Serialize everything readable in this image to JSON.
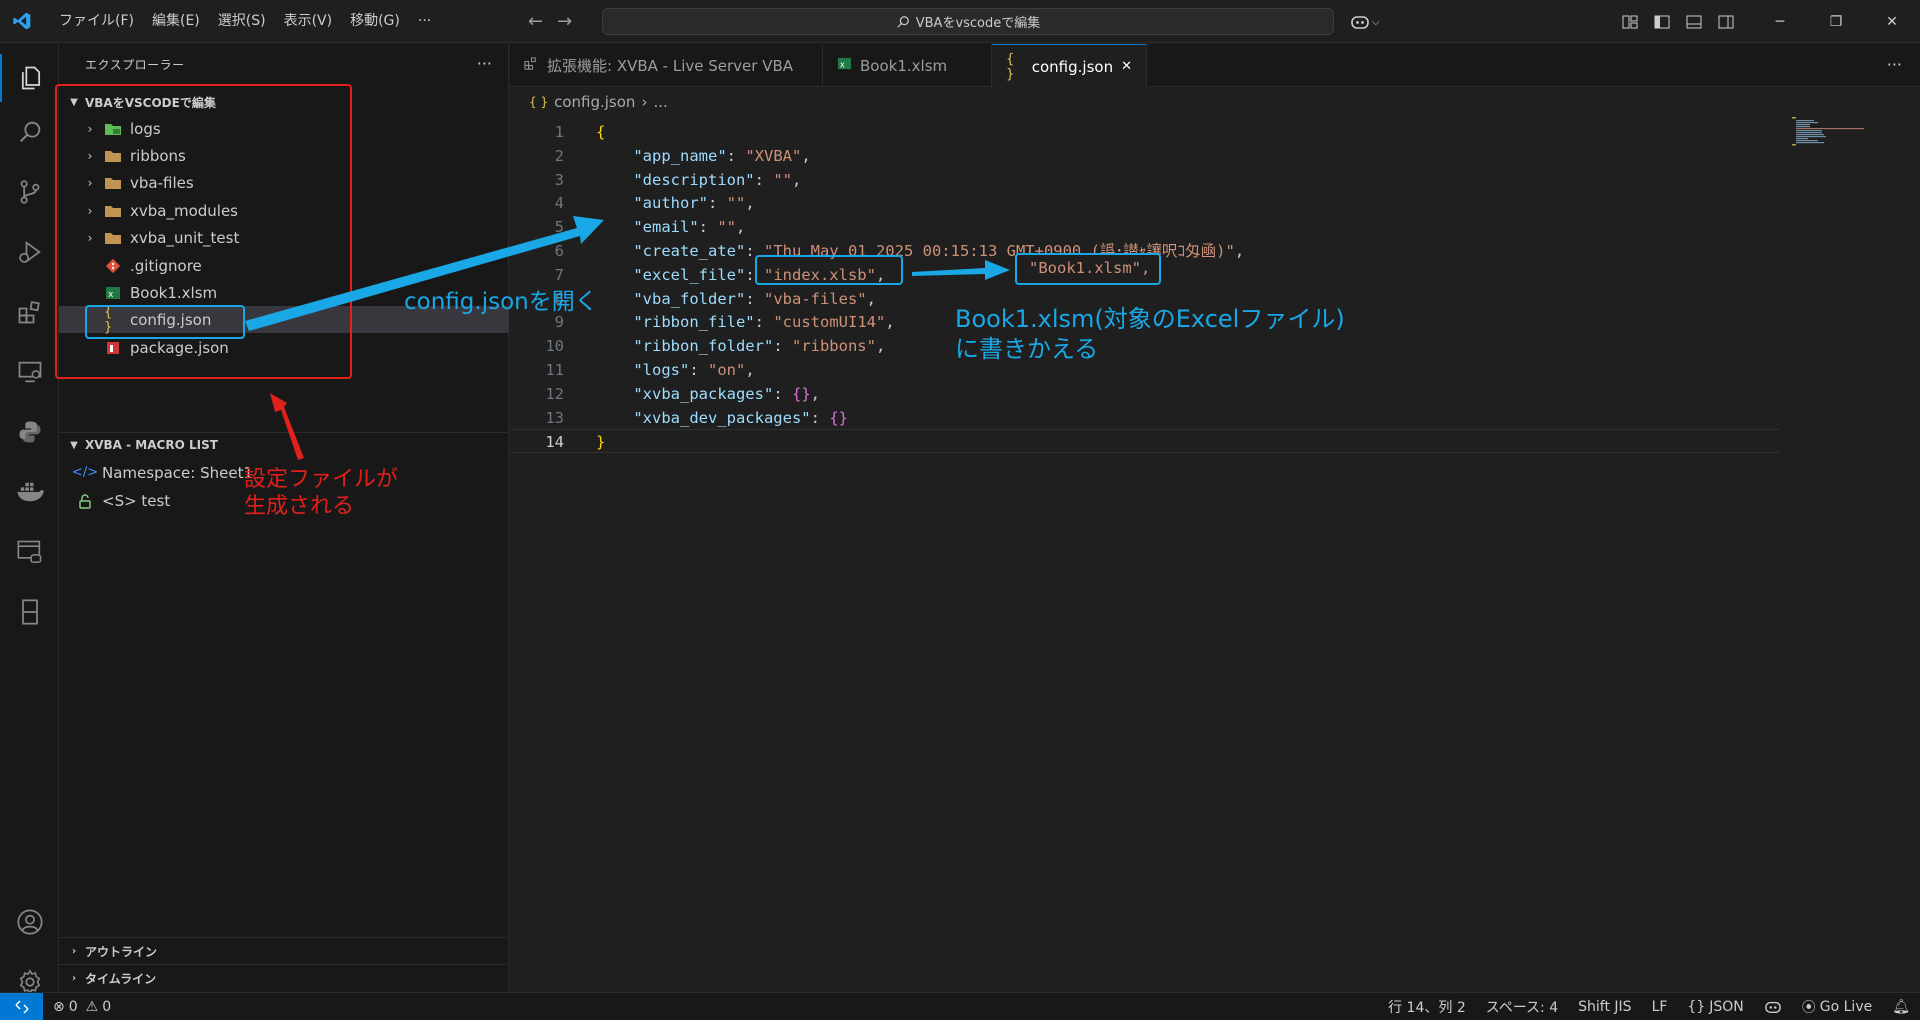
{
  "titlebar": {
    "menu": [
      "ファイル(F)",
      "編集(E)",
      "選択(S)",
      "表示(V)",
      "移動(G)",
      "···"
    ],
    "search_text": "VBAをvscodeで編集"
  },
  "sidebar": {
    "title": "エクスプローラー",
    "more": "···",
    "workspace_title": "VBAをVSCODEで編集",
    "tree": [
      {
        "label": "logs",
        "kind": "folder"
      },
      {
        "label": "ribbons",
        "kind": "folder"
      },
      {
        "label": "vba-files",
        "kind": "folder"
      },
      {
        "label": "xvba_modules",
        "kind": "folder"
      },
      {
        "label": "xvba_unit_test",
        "kind": "folder"
      },
      {
        "label": ".gitignore",
        "kind": "git"
      },
      {
        "label": "Book1.xlsm",
        "kind": "excel"
      },
      {
        "label": "config.json",
        "kind": "json"
      },
      {
        "label": "package.json",
        "kind": "npm"
      }
    ],
    "macro_title": "XVBA - MACRO LIST",
    "macro_items": [
      {
        "label": "Namespace: Sheet1",
        "icon": "code-icon"
      },
      {
        "label": "<S> test",
        "icon": "unlock-icon"
      }
    ],
    "outline_title": "アウトライン",
    "timeline_title": "タイムライン"
  },
  "tabs": [
    {
      "label": "拡張機能: XVBA - Live Server VBA",
      "icon": "extensions-icon"
    },
    {
      "label": "Book1.xlsm",
      "icon": "excel-icon"
    },
    {
      "label": "config.json",
      "icon": "json-icon",
      "close": "✕"
    }
  ],
  "breadcrumb": {
    "file": "config.json",
    "rest": "..."
  },
  "code": [
    {
      "n": "1",
      "parts": [
        [
          "b1",
          "{"
        ]
      ]
    },
    {
      "n": "2",
      "parts": [
        [
          "p",
          "    "
        ],
        [
          "k",
          "\"app_name\""
        ],
        [
          "p",
          ": "
        ],
        [
          "s",
          "\"XVBA\""
        ],
        [
          "p",
          ","
        ]
      ]
    },
    {
      "n": "3",
      "parts": [
        [
          "p",
          "    "
        ],
        [
          "k",
          "\"description\""
        ],
        [
          "p",
          ": "
        ],
        [
          "s",
          "\"\""
        ],
        [
          "p",
          ","
        ]
      ]
    },
    {
      "n": "4",
      "parts": [
        [
          "p",
          "    "
        ],
        [
          "k",
          "\"author\""
        ],
        [
          "p",
          ": "
        ],
        [
          "s",
          "\"\""
        ],
        [
          "p",
          ","
        ]
      ]
    },
    {
      "n": "5",
      "parts": [
        [
          "p",
          "    "
        ],
        [
          "k",
          "\"email\""
        ],
        [
          "p",
          ": "
        ],
        [
          "s",
          "\"\""
        ],
        [
          "p",
          ","
        ]
      ]
    },
    {
      "n": "6",
      "parts": [
        [
          "p",
          "    "
        ],
        [
          "k",
          "\"create_ate\""
        ],
        [
          "p",
          ": "
        ],
        [
          "s",
          "\"Thu May 01 2025 00:15:13 GMT+0900 (譌･譛ｬ讓呎ｺ匁凾)\""
        ],
        [
          "p",
          ","
        ]
      ]
    },
    {
      "n": "7",
      "parts": [
        [
          "p",
          "    "
        ],
        [
          "k",
          "\"excel_file\""
        ],
        [
          "p",
          ": "
        ],
        [
          "s",
          "\"index.xlsb\""
        ],
        [
          "p",
          ","
        ]
      ]
    },
    {
      "n": "8",
      "parts": [
        [
          "p",
          "    "
        ],
        [
          "k",
          "\"vba_folder\""
        ],
        [
          "p",
          ": "
        ],
        [
          "s",
          "\"vba-files\""
        ],
        [
          "p",
          ","
        ]
      ]
    },
    {
      "n": "9",
      "parts": [
        [
          "p",
          "    "
        ],
        [
          "k",
          "\"ribbon_file\""
        ],
        [
          "p",
          ": "
        ],
        [
          "s",
          "\"customUI14\""
        ],
        [
          "p",
          ","
        ]
      ]
    },
    {
      "n": "10",
      "parts": [
        [
          "p",
          "    "
        ],
        [
          "k",
          "\"ribbon_folder\""
        ],
        [
          "p",
          ": "
        ],
        [
          "s",
          "\"ribbons\""
        ],
        [
          "p",
          ","
        ]
      ]
    },
    {
      "n": "11",
      "parts": [
        [
          "p",
          "    "
        ],
        [
          "k",
          "\"logs\""
        ],
        [
          "p",
          ": "
        ],
        [
          "s",
          "\"on\""
        ],
        [
          "p",
          ","
        ]
      ]
    },
    {
      "n": "12",
      "parts": [
        [
          "p",
          "    "
        ],
        [
          "k",
          "\"xvba_packages\""
        ],
        [
          "p",
          ": "
        ],
        [
          "b2",
          "{}"
        ],
        [
          "p",
          ","
        ]
      ]
    },
    {
      "n": "13",
      "parts": [
        [
          "p",
          "    "
        ],
        [
          "k",
          "\"xvba_dev_packages\""
        ],
        [
          "p",
          ": "
        ],
        [
          "b2",
          "{}"
        ]
      ]
    },
    {
      "n": "14",
      "parts": [
        [
          "b1",
          "}"
        ]
      ]
    }
  ],
  "annotations": {
    "open_config": "config.jsonを開く",
    "generated_line1": "設定ファイルが",
    "generated_line2": "生成される",
    "replace_value": "\"Book1.xlsm\",",
    "replace_line1": "Book1.xlsm(対象のExcelファイル)",
    "replace_line2": "に書きかえる"
  },
  "statusbar": {
    "errors": "0",
    "warnings": "0",
    "position": "行 14、列 2",
    "spaces": "スペース: 4",
    "encoding": "Shift JIS",
    "eol": "LF",
    "language": "JSON",
    "golive": "Go Live"
  },
  "colors": {
    "accent": "#0078d4",
    "annotation_blue": "#1aa7e6",
    "annotation_red": "#e0201b"
  }
}
